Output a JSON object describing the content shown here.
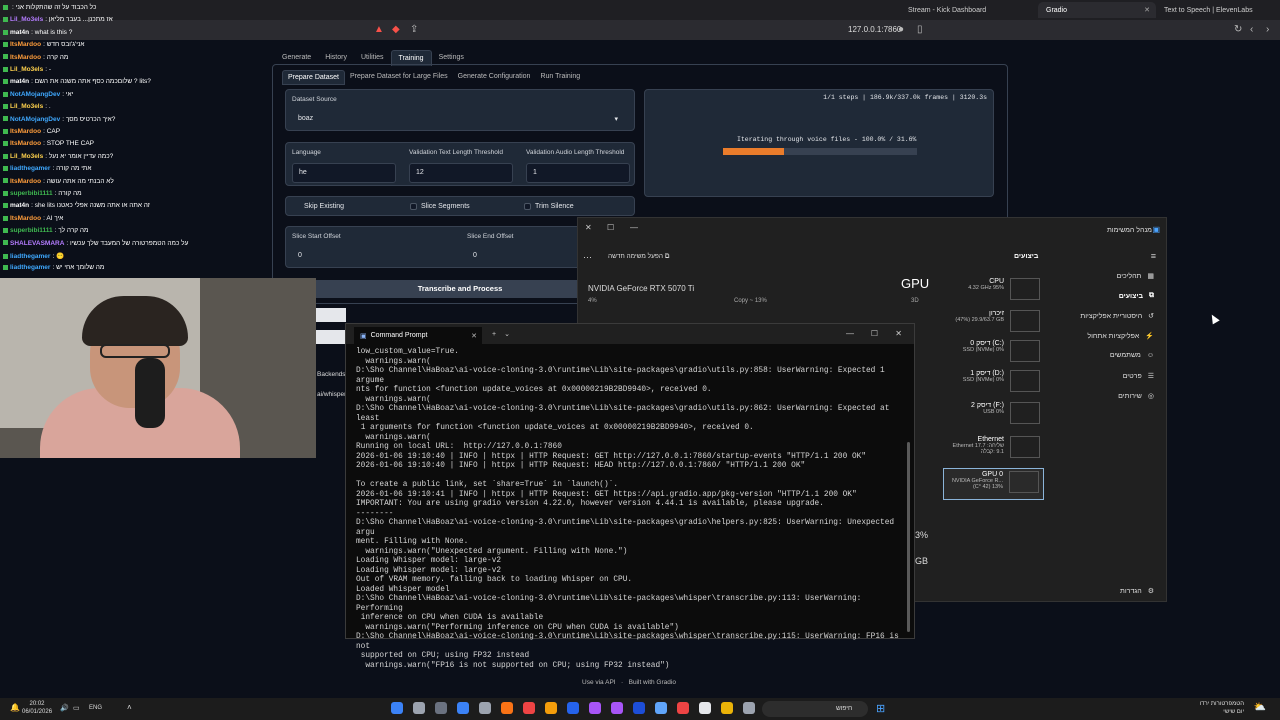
{
  "browser": {
    "tabs": [
      {
        "label": "Stream - Kick Dashboard"
      },
      {
        "label": "Gradio",
        "active": true
      },
      {
        "label": "Text to Speech | ElevenLabs"
      }
    ],
    "url": "127.0.0.1:7860"
  },
  "gradio": {
    "main_tabs": [
      "Generate",
      "History",
      "Utilities",
      "Training",
      "Settings"
    ],
    "active_main_tab": "Training",
    "sub_tabs": [
      "Prepare Dataset",
      "Prepare Dataset for Large Files",
      "Generate Configuration",
      "Run Training"
    ],
    "dataset_source": {
      "label": "Dataset Source",
      "value": "boaz"
    },
    "language": {
      "label": "Language",
      "value": "he"
    },
    "val_text_threshold": {
      "label": "Validation Text Length Threshold",
      "value": "12"
    },
    "val_audio_threshold": {
      "label": "Validation Audio Length Threshold",
      "value": "1"
    },
    "checkboxes": {
      "skip_existing": "Skip Existing",
      "slice_segments": "Slice Segments",
      "trim_silence": "Trim Silence"
    },
    "slice_start": {
      "label": "Slice Start Offset",
      "value": "0"
    },
    "slice_end": {
      "label": "Slice End Offset",
      "value": "0"
    },
    "transcribe_button": "Transcribe and Process",
    "progress": {
      "header": "1/1 steps | 186.9k/337.0k frames | 3120.3s",
      "status": "Iterating through voice files - 100.0% / 31.6%",
      "fraction": 0.316
    },
    "partial_labels": {
      "backends": "Backends",
      "whisper": "ai/whisper"
    },
    "footer": {
      "api": "Use via API",
      "built": "Built with Gradio"
    }
  },
  "chat": [
    {
      "user": "",
      "text": "כל הכבוד על זה שהתקלות אני",
      "color": "#ff4444"
    },
    {
      "user": "Lil_Mo3els",
      "text": "אז מתכנן... בעבר מליאן",
      "color": "#b47cff"
    },
    {
      "user": "mat4n",
      "text": "what is this ?",
      "color": "#fff"
    },
    {
      "user": "ItsMardoo",
      "text": "אני'ג'ובס חדש",
      "color": "#ff9d3b"
    },
    {
      "user": "ItsMardoo",
      "text": "מה קרה",
      "color": "#ff9d3b"
    },
    {
      "user": "Lil_Mo3els",
      "text": "-",
      "color": "#ffd24d"
    },
    {
      "user": "mat4n",
      "text": "שלוםכמה כסף אתה משנה את השם ? lits?",
      "color": "#fff"
    },
    {
      "user": "NotAMojangDev",
      "text": "יאי",
      "color": "#3fa9ff"
    },
    {
      "user": "Lil_Mo3els",
      "text": ".",
      "color": "#ffd24d"
    },
    {
      "user": "NotAMojangDev",
      "text": "איך הכרטיס מסך?",
      "color": "#3fa9ff"
    },
    {
      "user": "ItsMardoo",
      "text": "CAP",
      "color": "#ff9d3b"
    },
    {
      "user": "ItsMardoo",
      "text": "STOP THE CAP",
      "color": "#ff9d3b"
    },
    {
      "user": "Lil_Mo3els",
      "text": "כמה עדיין אומר יא נעל?",
      "color": "#ffd24d"
    },
    {
      "user": "liadthegamer",
      "text": "אתי מה קורה",
      "color": "#3fa9ff"
    },
    {
      "user": "ItsMardoo",
      "text": "לא הבנתי מה אתה עושה",
      "color": "#ff9d3b"
    },
    {
      "user": "superbibi1111",
      "text": "מה קורה",
      "color": "#3fb950"
    },
    {
      "user": "mat4n",
      "text": "she lits זה אתה או אתה משנה אפלי כאטנו",
      "color": "#fff"
    },
    {
      "user": "ItsMardoo",
      "text": "AI איך",
      "color": "#ff9d3b"
    },
    {
      "user": "superbibi1111",
      "text": "מה קרה לך",
      "color": "#3fb950"
    },
    {
      "user": "SHALEVASMARA",
      "text": "על כמה הטמפרטורה של המעבד שלך עכשיו",
      "color": "#b47cff"
    },
    {
      "user": "liadthegamer",
      "text": "😶",
      "color": "#3fa9ff"
    },
    {
      "user": "liadthegamer",
      "text": "מה שלומך אחי יש",
      "color": "#3fa9ff"
    }
  ],
  "cmd": {
    "title": "Command Prompt",
    "lines": [
      "low_custom_value=True.",
      "  warnings.warn(",
      "D:\\Sho Channel\\HaBoaz\\ai-voice-cloning-3.0\\runtime\\Lib\\site-packages\\gradio\\utils.py:858: UserWarning: Expected 1 argume",
      "nts for function <function update_voices at 0x00000219B2BD9940>, received 0.",
      "  warnings.warn(",
      "D:\\Sho Channel\\HaBoaz\\ai-voice-cloning-3.0\\runtime\\Lib\\site-packages\\gradio\\utils.py:862: UserWarning: Expected at least",
      " 1 arguments for function <function update_voices at 0x00000219B2BD9940>, received 0.",
      "  warnings.warn(",
      "Running on local URL:  http://127.0.0.1:7860",
      "2026-01-06 19:10:40 | INFO | httpx | HTTP Request: GET http://127.0.0.1:7860/startup-events \"HTTP/1.1 200 OK\"",
      "2026-01-06 19:10:40 | INFO | httpx | HTTP Request: HEAD http://127.0.0.1:7860/ \"HTTP/1.1 200 OK\"",
      "",
      "To create a public link, set `share=True` in `launch()`.",
      "2026-01-06 19:10:41 | INFO | httpx | HTTP Request: GET https://api.gradio.app/pkg-version \"HTTP/1.1 200 OK\"",
      "IMPORTANT: You are using gradio version 4.22.0, however version 4.44.1 is available, please upgrade.",
      "--------",
      "D:\\Sho Channel\\HaBoaz\\ai-voice-cloning-3.0\\runtime\\Lib\\site-packages\\gradio\\helpers.py:825: UserWarning: Unexpected argu",
      "ment. Filling with None.",
      "  warnings.warn(\"Unexpected argument. Filling with None.\")",
      "Loading Whisper model: large-v2",
      "Loading Whisper model: large-v2",
      "Out of VRAM memory. falling back to loading Whisper on CPU.",
      "Loaded Whisper model",
      "D:\\Sho Channel\\HaBoaz\\ai-voice-cloning-3.0\\runtime\\Lib\\site-packages\\whisper\\transcribe.py:113: UserWarning: Performing",
      " inference on CPU when CUDA is available",
      "  warnings.warn(\"Performing inference on CPU when CUDA is available\")",
      "D:\\Sho Channel\\HaBoaz\\ai-voice-cloning-3.0\\runtime\\Lib\\site-packages\\whisper\\transcribe.py:115: UserWarning: FP16 is not",
      " supported on CPU; using FP32 instead",
      "  warnings.warn(\"FP16 is not supported on CPU; using FP32 instead\")"
    ]
  },
  "taskmgr": {
    "title": "מנהל המשימות",
    "section": "ביצועים",
    "new_task": "הפעל משימה חדשה",
    "gpu_name": "NVIDIA GeForce RTX 5070 Ti",
    "gpu_big": "GPU",
    "copy_label": "Copy ~ 13%",
    "pct_4": "4%",
    "label_3d": "3D",
    "partial_3": "3%",
    "partial_gb": "GB",
    "side": [
      "תהליכים",
      "ביצועים",
      "היסטוריית אפליקציות",
      "אפליקציות אתחול",
      "משתמשים",
      "פרטים",
      "שירותים"
    ],
    "settings": "הגדרות",
    "cards": [
      {
        "name": "CPU",
        "sub": "4.32 GHz 95%"
      },
      {
        "name": "זיכרון",
        "sub": "(47%) 29.9/63.7 GB"
      },
      {
        "name": "דיסק 0 (C:)",
        "sub": "SSD (NVMe) 0%"
      },
      {
        "name": "דיסק 1 (D:)",
        "sub": "SSD (NVMe) 0%"
      },
      {
        "name": "דיסק 2 (F:)",
        "sub": "USB 0%"
      },
      {
        "name": "Ethernet",
        "sub": "Ethernet  17.7 :שליחה 9.1 :קבלה"
      },
      {
        "name": "GPU 0",
        "sub": "NVIDIA GeForce R... (C° 42) 13%"
      }
    ]
  },
  "taskbar": {
    "time": "20:02",
    "date": "06/01/2026",
    "lang": "ENG",
    "search": "חיפוש",
    "weather": "הטמפרטורות ירדו",
    "weather_sub": "יום שישי"
  },
  "colors": {
    "accent": "#ea7c2b",
    "bg": "#0b0f19",
    "panel": "#1f2937"
  }
}
